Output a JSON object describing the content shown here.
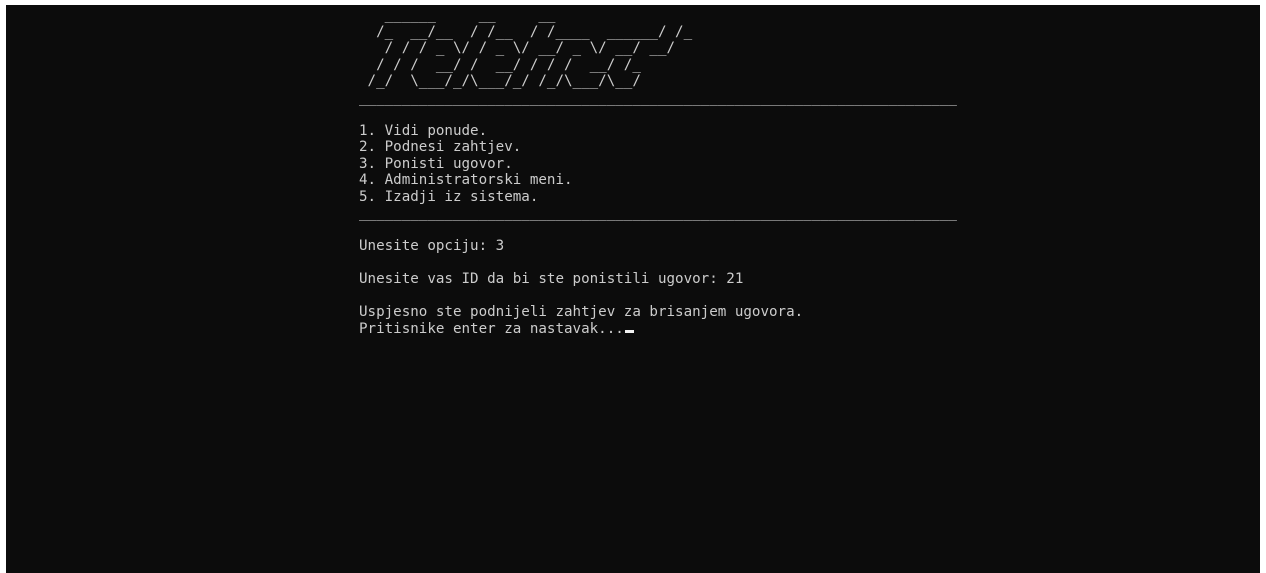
{
  "logo_ascii": "   ______     __     __\n  /_  __/__  / /__  / /____  ______/ /_\n   / / / _ \\/ / _ \\/ __/ _ \\/ __/ __/\n  / / /  __/ /  __/ / / /  __/ /_\n /_/  \\___/_/\\___/_/ /_/\\___/\\__/",
  "logo_text": "Telenet",
  "divider": "______________________________________________________________________",
  "menu": [
    "1. Vidi ponude.",
    "2. Podnesi zahtjev.",
    "3. Ponisti ugovor.",
    "4. Administratorski meni.",
    "5. Izadji iz sistema."
  ],
  "prompt_option": "Unesite opciju: 3",
  "prompt_id": "Unesite vas ID da bi ste ponistili ugovor: 21",
  "message_success": "Uspjesno ste podnijeli zahtjev za brisanjem ugovora.",
  "message_continue": "Pritisnike enter za nastavak..."
}
